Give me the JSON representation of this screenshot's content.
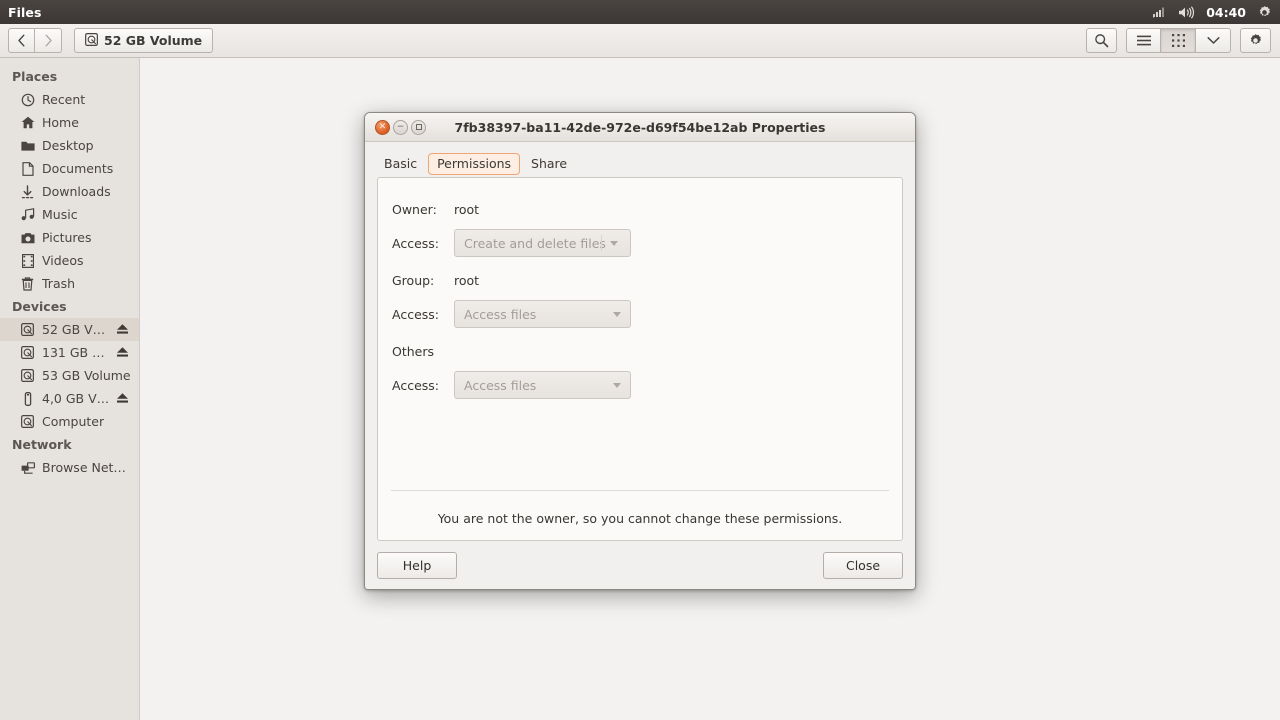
{
  "panel": {
    "app_name": "Files",
    "clock": "04:40",
    "tray_icons": [
      "network-signal-icon",
      "volume-icon",
      "system-settings-gear-icon"
    ]
  },
  "toolbar": {
    "back_label": "‹",
    "forward_label": "›",
    "breadcrumb": {
      "label": "52 GB Volume",
      "icon": "drive-harddisk-icon"
    },
    "search_icon": "search-icon",
    "list_view_icon": "list-view-icon",
    "grid_view_icon": "grid-view-icon",
    "grid_view_active": true,
    "chevron_icon": "chevron-down-icon",
    "gear_icon": "gear-icon"
  },
  "sidebar": {
    "sections": [
      {
        "heading": "Places",
        "items": [
          {
            "label": "Recent",
            "icon": "clock-icon",
            "selected": false,
            "eject": false
          },
          {
            "label": "Home",
            "icon": "home-icon",
            "selected": false,
            "eject": false
          },
          {
            "label": "Desktop",
            "icon": "folder-icon",
            "selected": false,
            "eject": false
          },
          {
            "label": "Documents",
            "icon": "document-icon",
            "selected": false,
            "eject": false
          },
          {
            "label": "Downloads",
            "icon": "download-icon",
            "selected": false,
            "eject": false
          },
          {
            "label": "Music",
            "icon": "music-icon",
            "selected": false,
            "eject": false
          },
          {
            "label": "Pictures",
            "icon": "camera-icon",
            "selected": false,
            "eject": false
          },
          {
            "label": "Videos",
            "icon": "film-icon",
            "selected": false,
            "eject": false
          },
          {
            "label": "Trash",
            "icon": "trash-icon",
            "selected": false,
            "eject": false
          }
        ]
      },
      {
        "heading": "Devices",
        "items": [
          {
            "label": "52 GB V…",
            "icon": "drive-harddisk-icon",
            "selected": true,
            "eject": true
          },
          {
            "label": "131 GB …",
            "icon": "drive-harddisk-icon",
            "selected": false,
            "eject": true
          },
          {
            "label": "53 GB Volume",
            "icon": "drive-harddisk-icon",
            "selected": false,
            "eject": false
          },
          {
            "label": "4,0 GB V…",
            "icon": "usb-drive-icon",
            "selected": false,
            "eject": true
          },
          {
            "label": "Computer",
            "icon": "drive-harddisk-icon",
            "selected": false,
            "eject": false
          }
        ]
      },
      {
        "heading": "Network",
        "items": [
          {
            "label": "Browse Net…",
            "icon": "network-icon",
            "selected": false,
            "eject": false
          }
        ]
      }
    ]
  },
  "dialog": {
    "title": "7fb38397-ba11-42de-972e-d69f54be12ab Properties",
    "window_controls": {
      "close": "×",
      "minimize": "−",
      "maximize": "maximize-icon"
    },
    "tabs": [
      {
        "label": "Basic",
        "active": false
      },
      {
        "label": "Permissions",
        "active": true
      },
      {
        "label": "Share",
        "active": false
      }
    ],
    "permissions": {
      "owner": {
        "label": "Owner:",
        "value": "root",
        "access_label": "Access:",
        "access_value": "Create and delete files",
        "disabled": true
      },
      "group": {
        "label": "Group:",
        "value": "root",
        "access_label": "Access:",
        "access_value": "Access files",
        "disabled": true
      },
      "others": {
        "label": "Others",
        "access_label": "Access:",
        "access_value": "Access files",
        "disabled": true
      },
      "note": "You are not the owner, so you cannot change these permissions."
    },
    "buttons": {
      "help": "Help",
      "close": "Close"
    }
  },
  "colors": {
    "panel_bg": "#403a38",
    "sidebar_bg": "#e6e2dd",
    "sidebar_selected": "#dcd6cf",
    "file_area_bg": "#f4f2f0",
    "dialog_bg": "#f2f0ee",
    "content_bg": "#fbfaf9",
    "accent_orange": "#df642d",
    "tab_focus_ring": "#f0a373"
  }
}
